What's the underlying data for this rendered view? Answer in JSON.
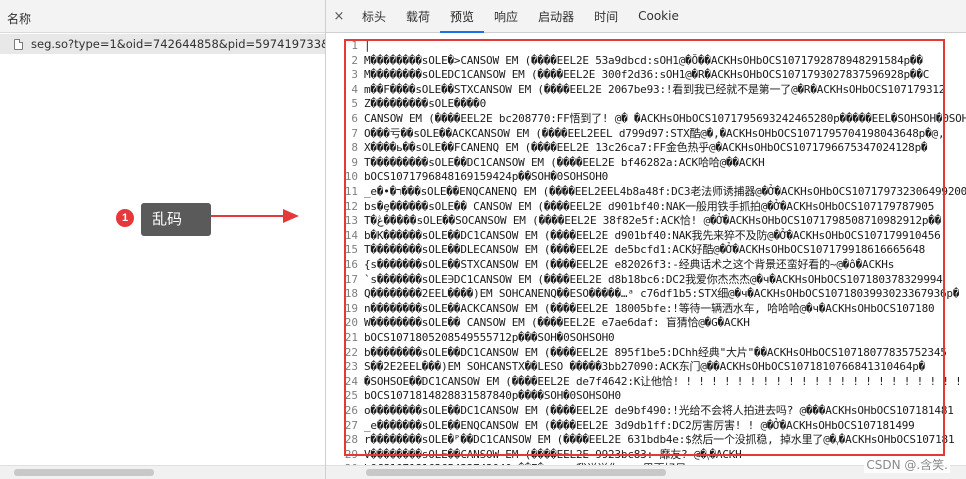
{
  "left_panel": {
    "header_label": "名称",
    "request_name": "seg.so?type=1&oid=742644858&pid=597419733&s..."
  },
  "tabs": [
    {
      "label": "标头"
    },
    {
      "label": "载荷"
    },
    {
      "label": "预览",
      "active": true
    },
    {
      "label": "响应"
    },
    {
      "label": "启动器"
    },
    {
      "label": "时间"
    },
    {
      "label": "Cookie"
    }
  ],
  "close_glyph": "×",
  "annotation": {
    "number": "1",
    "label": "乱码",
    "color": "#e5383b"
  },
  "code_lines": [
    {
      "n": "1",
      "t": "|"
    },
    {
      "n": "2",
      "t": "M��������sOLE�>CANSOW  EM (����EEL2E 53a9dbcd:sOH1@�Ŏ��ACKHsOHbOCS1071792878948291584p��"
    },
    {
      "n": "3",
      "t": "M��������sOLEDC1CANSOW  EM (����EEL2E 300f2d36:sOH1@�R�ACKHsOHbOCS1071793027837596928p��C"
    },
    {
      "n": "4",
      "t": "m��F����sOLE��STXCANSOW  EM (����EEL2E 2067be93:!看到我已经就不是第一了@�R�ACKHsOHbOCS107179312"
    },
    {
      "n": "5",
      "t": "Z���������sOLE����0"
    },
    {
      "n": "6",
      "t": "CANSOW  EM (����EEL2E bc208770:FF悟到了! @� �ACKHsOHbOCS1071795693242465280p�����EEL�SOHSOH�0SOHSOH0"
    },
    {
      "n": "7",
      "t": "O���亏��sOLE��ACKCANSOW  EM (����EEL2EEL d799d97:STX酷@�,�ACKHsOHbOCS1071795704198043648p�@,"
    },
    {
      "n": "8",
      "t": "X����ь��sOLE��FCANENQ  EM (����EEL2E 13c26ca7:FF金色热乎@�ACKHsOHbOCS1071796675347024128p�"
    },
    {
      "n": "9",
      "t": "T���������sOLE��DC1CANSOW  EM (����EEL2E bf46282a:ACK哈哈@��ACKH"
    },
    {
      "n": "10",
      "t": "bOCS1071796848169159424p��SOH�0SOHSOH0"
    },
    {
      "n": "11",
      "t": "_e�•�ר���sOLE��ENQCANENQ  EM (����EEL2EEL4b8a48f:DC3老法师诱捕器@�Ở�ACKHsOHbOCS1071797323064992000p�"
    },
    {
      "n": "12",
      "t": "bs�ȩ������sOLE��   CANSOW  EM (����EEL2E d901bf40:NAK一般用铁手抓拍@�Ở�ACKHsOHbOCS107179787905"
    },
    {
      "n": "13",
      "t": "T�ڠ�����sOLE��SOCANSOW  EM (����EEL2E 38f82e5f:ACK恰! @�Ở�ACKHsOHbOCS1071798508710982912p��"
    },
    {
      "n": "14",
      "t": "b�K������sOLE��DC1CANSOW  EM (����EEL2E d901bf40:NAK我先来猝不及防@�Ở�ACKHsOHbOCS107179910456"
    },
    {
      "n": "15",
      "t": "T��������sOLE��DLECANSOW  EM (����EEL2E de5bcfd1:ACK好酷@�Ở�ACKHsOHbOCS107179918616665648"
    },
    {
      "n": "16",
      "t": "{s�������sOLE��STXCANSOW  EM (����EEL2E e82026f3:-经典话术之这个背景还蛮好看的~@�ô�ACKHs"
    },
    {
      "n": "17",
      "t": "`s�������sOLE∋DC1CANSOW  EM (����EEL2E d8b18bc6:DC2我爱你杰杰杰@�ч�ACKHsOHbOCS107180378329994"
    },
    {
      "n": "18",
      "t": "Q��������2EEL����)EM  SOHCANENQ��ESO�����…ᵃ c76df1b5:STX细@�ч�ACKHsOHbOCS1071803993023367936p�"
    },
    {
      "n": "19",
      "t": "n��������sOLE��ACKCANSOW  EM (����EEL2E 18005bfe:!等待一辆洒水车, 哈哈哈@�ч�ACKHsOHbOCS107180"
    },
    {
      "n": "20",
      "t": "W��������sOLE��   CANSOW  EM (����EEL2E e7ae6daf:  盲猜恰@�G�ACKH"
    },
    {
      "n": "21",
      "t": "bOCS1071805208549555712p���SOH�0SOHSOH0"
    },
    {
      "n": "22",
      "t": "b��������sOLE��DC1CANSOW  EM (����EEL2E 895f1be5:DChh经典\"大片\"��ACKHsOHbOCS10718077835752345"
    },
    {
      "n": "23",
      "t": "S��2E2EEL���)EM  SOHCANSTX��LESO �����3bb27090:ACK东门@��ACKHsOHbOCS1071810766841310464p�"
    },
    {
      "n": "24",
      "t": "�SOHSOE��DC1CANSOW  EM (����EEL2E de7f4642:K让他恰! ! ! ! ! ! ! ! ! ! ! ! ! ! ! ! ! ! ! ! ! ! ! !"
    },
    {
      "n": "25",
      "t": "bOCS1071814828831587840p����SOH�0SOHSOH0"
    },
    {
      "n": "26",
      "t": "o��������sOLE��DC1CANSOW  EM (����EEL2E de9bf490:!光给不会将人拍进去吗? @���ACKHsOHbOCS107181481"
    },
    {
      "n": "27",
      "t": "_e�������sOLE��ENQCANSOW  EM (����EEL2E 3d9db1ff:DC2厉害厉害! ! @�Ở�ACKHsOHbOCS107181499"
    },
    {
      "n": "28",
      "t": "r��������sOLE�ᴾ��DC1CANSOW  EM (����EEL2E 631bdb4e:$然后一个没抓稳, 掉水里了@�ᵧ�ACKHsOHbOCS107181"
    },
    {
      "n": "29",
      "t": "V��������sOLE��CANSOW  EM (����EEL2E 9923bc83:  靡友? @�ᵧ�ACKH"
    },
    {
      "n": "30",
      "t": "bOCS1071816265422743040p��E�……………我说送你一……里更好是……"
    }
  ],
  "watermark": "CSDN @.含笑."
}
